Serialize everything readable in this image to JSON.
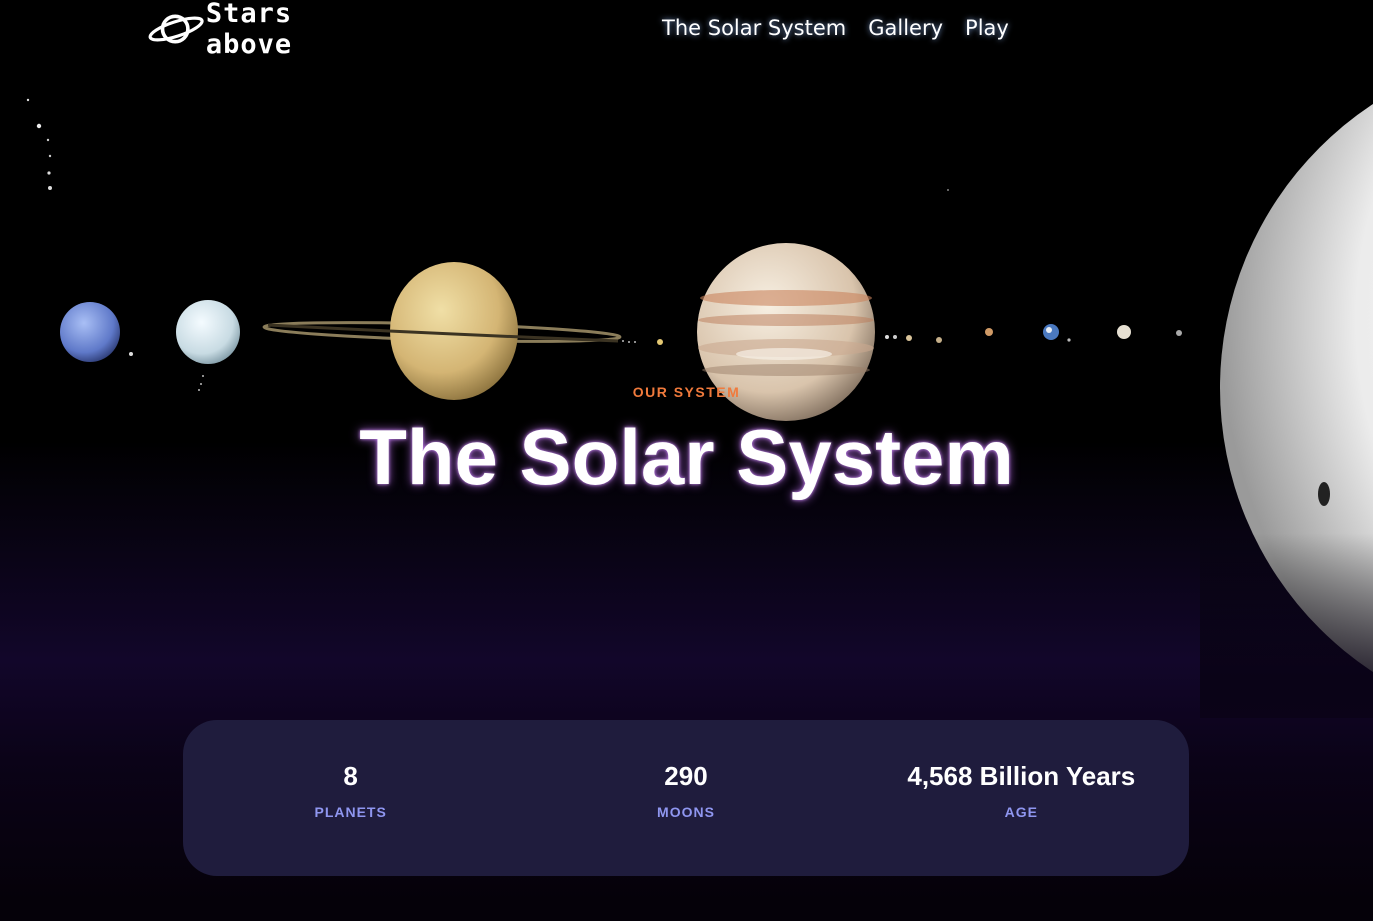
{
  "header": {
    "logo_text": "Stars above",
    "nav": [
      "The Solar System",
      "Gallery",
      "Play"
    ]
  },
  "hero": {
    "eyebrow": "OUR SYSTEM",
    "title": "The Solar System"
  },
  "stats": [
    {
      "value": "8",
      "label": "PLANETS"
    },
    {
      "value": "290",
      "label": "MOONS"
    },
    {
      "value": "4,568 Billion Years",
      "label": "AGE"
    }
  ],
  "colors": {
    "accent": "#f07a3c",
    "stat_label": "#8f96f0",
    "stats_bg": "#1f1c3d"
  }
}
